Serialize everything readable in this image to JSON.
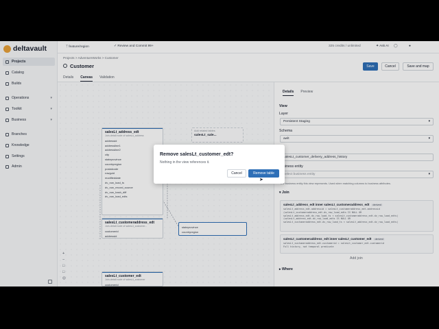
{
  "app": {
    "logo": "deltavault"
  },
  "sidebar": {
    "items": [
      {
        "label": "Projects",
        "active": true
      },
      {
        "label": "Catalog"
      },
      {
        "label": "Builds"
      },
      {
        "label": "Operations",
        "chevron": true
      },
      {
        "label": "Toolkit",
        "chevron": true
      },
      {
        "label": "Business",
        "chevron": true
      },
      {
        "label": "Branches"
      },
      {
        "label": "Knowledge"
      },
      {
        "label": "Settings"
      },
      {
        "label": "Admin"
      }
    ]
  },
  "topbar": {
    "branch": "feature/region",
    "review": "Review and Commit",
    "review_count": "99+",
    "credits": "325 credits / unlimited",
    "ask_ai": "Ask AI"
  },
  "header": {
    "breadcrumb": "Projects  >  AdventureWorks  >  Customer",
    "title": "Customer",
    "save": "Save",
    "cancel": "Cancel",
    "save_and_map": "Save and map"
  },
  "tabs": [
    "Details",
    "Canvas",
    "Validation"
  ],
  "canvas": {
    "related_hint_title": "Add related tables",
    "related_hint_node": "salesLt_sale...",
    "related_hint_sub": "Join-detail node of salesLt_salesOrderHeader",
    "node1": {
      "title": "salesLt_address_edt",
      "sub": "Join-detail node of salesLt_address",
      "columns": [
        "addressid",
        "addressline1",
        "addressline2",
        "city",
        "stateprovince",
        "countryregion",
        "postalcode",
        "rowguid",
        "modifieddate",
        "dv_row_load_ts",
        "dv_row_record_source",
        "dv_row_hash_diff",
        "dv_row_load_edts"
      ],
      "tag": "generated"
    },
    "node2": {
      "title": "salesLt_customeraddress_edt",
      "sub": "Join-detail node of salesLt_customer...",
      "columns": [
        "customerid",
        "addressid"
      ]
    },
    "node3": {
      "columns": [
        "stateprovince",
        "countryregion"
      ]
    },
    "node4": {
      "title": "salesLt_customer_edt",
      "sub": "Join-detail node of salesLt_customer",
      "columns": [
        "customerid"
      ]
    }
  },
  "panel": {
    "tabs": [
      "Details",
      "Preview"
    ],
    "view_label": "View",
    "layer_label": "Layer",
    "layer_value": "Persistent Staging",
    "schema_label": "Schema",
    "schema_value": "awlt",
    "name_value": "salesLt_customer_delivery_address_history",
    "business_entity_label": "Business entity",
    "business_entity_placeholder": "Select business entity",
    "business_entity_help": "The business entity this view represents. Used when matching columns to business attributes.",
    "join_label": "Join",
    "join1_title": "salesLt_address_edt inner salesLt_customeraddress_edt",
    "join1_badge": "derived",
    "join1_code": [
      "salesLt_address_edt.addressid = salesLt_customeraddress_edt.addressid",
      "(salesLt_customeraddress_edt.dv_row_load_edts IS NULL OR",
      "salesLt_address_edt.dv_row_load_ts < salesLt_customeraddress_edt.dv_row_load_edts)",
      "(salesLt_address_edt.dv_row_load_edts IS NULL OR",
      "salesLt_customeraddress_edt.dv_row_load_ts < salesLt_address_edt.dv_row_load_edts)"
    ],
    "join2_title": "salesLt_customeraddress_edt inner salesLt_customer_edt",
    "join2_badge": "derived",
    "join2_code": [
      "salesLt_customeraddress_edt.customerid = salesLt_customer_edt.customerid",
      "Full history, not temporal predicate"
    ],
    "add_join": "Add join",
    "where_label": "Where"
  },
  "dialog": {
    "title": "Remove salesLt_customer_edt?",
    "message": "Nothing in the view references it.",
    "cancel": "Cancel",
    "confirm": "Remove table"
  }
}
